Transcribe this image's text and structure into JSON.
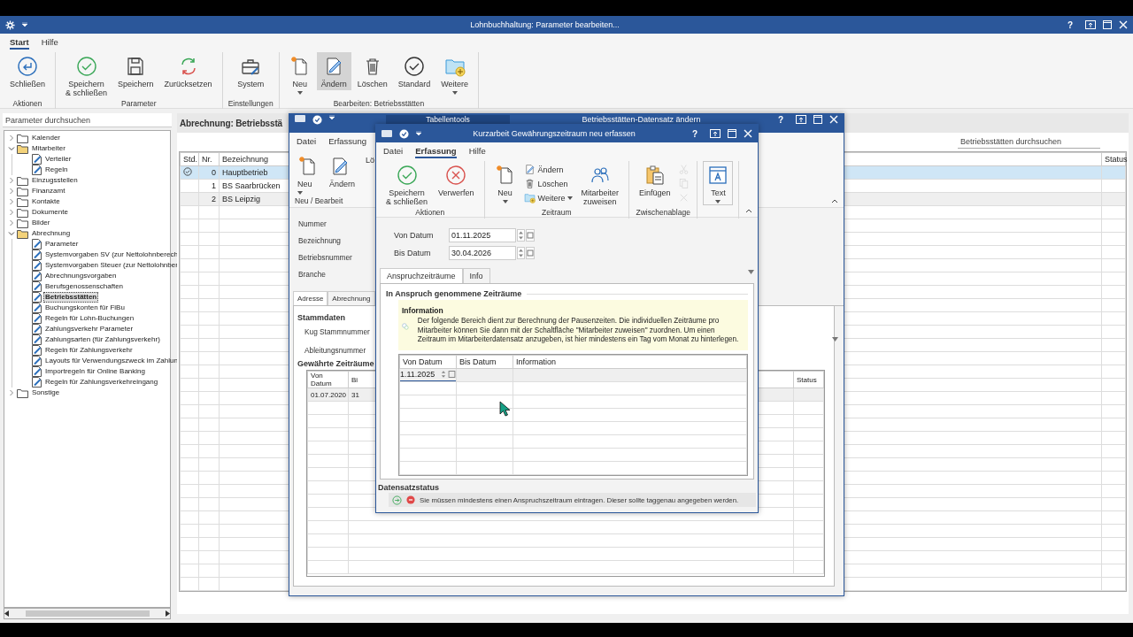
{
  "window": {
    "title": "Lohnbuchhaltung: Parameter bearbeiten...",
    "help": "?"
  },
  "ribbon": {
    "tabs": [
      {
        "label": "Start",
        "selected": true
      },
      {
        "label": "Hilfe",
        "selected": false
      }
    ],
    "groups": [
      {
        "label": "Aktionen",
        "buttons": [
          {
            "label": "Schließen",
            "pressed": false,
            "dropdown": false
          }
        ]
      },
      {
        "label": "Parameter",
        "buttons": [
          {
            "label": "Speichern\n& schließen",
            "pressed": false,
            "dropdown": false
          },
          {
            "label": "Speichern",
            "pressed": false,
            "dropdown": false
          },
          {
            "label": "Zurücksetzen",
            "pressed": false,
            "dropdown": false
          }
        ]
      },
      {
        "label": "Einstellungen",
        "buttons": [
          {
            "label": "System",
            "pressed": false,
            "dropdown": false
          }
        ]
      },
      {
        "label": "Bearbeiten: Betriebsstätten",
        "buttons": [
          {
            "label": "Neu",
            "pressed": false,
            "dropdown": true
          },
          {
            "label": "Ändern",
            "pressed": true,
            "dropdown": false
          },
          {
            "label": "Löschen",
            "pressed": false,
            "dropdown": false
          },
          {
            "label": "Standard",
            "pressed": false,
            "dropdown": false
          },
          {
            "label": "Weitere",
            "pressed": false,
            "dropdown": true
          }
        ]
      }
    ]
  },
  "sidebar": {
    "search": {
      "placeholder": "Parameter durchsuchen"
    },
    "tree": [
      {
        "kind": "folder",
        "label": "Kalender",
        "expanded": false,
        "selected": false
      },
      {
        "kind": "folder",
        "label": "Mitarbeiter",
        "expanded": true,
        "selected": false,
        "children": [
          {
            "kind": "leaf",
            "label": "Verteiler",
            "selected": false
          },
          {
            "kind": "leaf",
            "label": "Regeln",
            "selected": false
          }
        ]
      },
      {
        "kind": "folder",
        "label": "Einzugsstellen",
        "expanded": false,
        "selected": false
      },
      {
        "kind": "folder",
        "label": "Finanzamt",
        "expanded": false,
        "selected": false
      },
      {
        "kind": "folder",
        "label": "Kontakte",
        "expanded": false,
        "selected": false
      },
      {
        "kind": "folder",
        "label": "Dokumente",
        "expanded": false,
        "selected": false
      },
      {
        "kind": "folder",
        "label": "Bilder",
        "expanded": false,
        "selected": false
      },
      {
        "kind": "folder",
        "label": "Abrechnung",
        "expanded": true,
        "selected": false,
        "children": [
          {
            "kind": "leaf",
            "label": "Parameter",
            "selected": false
          },
          {
            "kind": "leaf",
            "label": "Systemvorgaben SV (zur Nettolohnberech",
            "selected": false
          },
          {
            "kind": "leaf",
            "label": "Systemvorgaben Steuer (zur Nettolohnber",
            "selected": false
          },
          {
            "kind": "leaf",
            "label": "Abrechnungsvorgaben",
            "selected": false
          },
          {
            "kind": "leaf",
            "label": "Berufsgenossenschaften",
            "selected": false
          },
          {
            "kind": "leaf",
            "label": "Betriebsstätten",
            "selected": true
          },
          {
            "kind": "leaf",
            "label": "Buchungskonten für FiBu",
            "selected": false
          },
          {
            "kind": "leaf",
            "label": "Regeln für Lohn-Buchungen",
            "selected": false
          },
          {
            "kind": "leaf",
            "label": "Zahlungsverkehr Parameter",
            "selected": false
          },
          {
            "kind": "leaf",
            "label": "Zahlungsarten (für Zahlungsverkehr)",
            "selected": false
          },
          {
            "kind": "leaf",
            "label": "Regeln für Zahlungsverkehr",
            "selected": false
          },
          {
            "kind": "leaf",
            "label": "Layouts für Verwendungszweck im Zahlun",
            "selected": false
          },
          {
            "kind": "leaf",
            "label": "Importregeln für Online Banking",
            "selected": false
          },
          {
            "kind": "leaf",
            "label": "Regeln für Zahlungsverkehreingang",
            "selected": false
          }
        ]
      },
      {
        "kind": "folder",
        "label": "Sonstige",
        "expanded": false,
        "selected": false
      }
    ]
  },
  "content": {
    "title": "Abrechnung: Betriebsstä",
    "search": {
      "placeholder": "Betriebsstätten durchsuchen"
    },
    "table": {
      "columns": [
        "Std.",
        "Nr.",
        "Bezeichnung",
        "Status"
      ],
      "rows": [
        {
          "default": true,
          "nr": "0",
          "name": "Hauptbetrieb",
          "selected": true
        },
        {
          "default": false,
          "nr": "1",
          "name": "BS Saarbrücken",
          "selected": false
        },
        {
          "default": false,
          "nr": "2",
          "name": "BS Leipzig",
          "selected": false
        }
      ]
    }
  },
  "edit_dialog": {
    "context_tab": "Tabellentools",
    "title": "Betriebsstätten-Datensatz ändern",
    "help": "?",
    "tabs": [
      {
        "label": "Datei",
        "selected": false
      },
      {
        "label": "Erfassung",
        "selected": false
      }
    ],
    "groups": [
      {
        "label": "Neu / Bearbeit",
        "buttons": [
          {
            "label": "Neu",
            "dropdown": true
          },
          {
            "label": "Ändern",
            "dropdown": false
          },
          {
            "label": "Lö",
            "dropdown": false
          }
        ]
      }
    ],
    "fields": [
      "Nummer",
      "Bezeichnung",
      "Betriebsnummer",
      "Branche"
    ],
    "tabs2": [
      {
        "label": "Adresse",
        "selected": true
      },
      {
        "label": "Abrechnung",
        "selected": false
      }
    ],
    "master_section": "Stammdaten",
    "master_fields": [
      "Kug Stammnummer",
      "Ableitungsnummer"
    ],
    "periods_section": "Gewährte Zeiträume",
    "periods_table": {
      "columns": [
        "Von Datum",
        "Bi",
        "Status"
      ],
      "rows": [
        {
          "cells": [
            "01.07.2020",
            "31"
          ],
          "selected": true
        }
      ]
    }
  },
  "period_dialog": {
    "title": "Kurzarbeit Gewährungszeitraum neu erfassen",
    "help": "?",
    "tabs": [
      {
        "label": "Datei",
        "selected": false
      },
      {
        "label": "Erfassung",
        "selected": true
      },
      {
        "label": "Hilfe",
        "selected": false
      }
    ],
    "groups": [
      {
        "label": "Aktionen",
        "buttons": [
          {
            "kind": "large",
            "label": "Speichern\n& schließen",
            "dropdown": false,
            "disabled": false
          },
          {
            "kind": "large",
            "label": "Verwerfen",
            "dropdown": false,
            "disabled": false
          }
        ]
      },
      {
        "label": "Zeitraum",
        "buttons": [
          {
            "kind": "large",
            "label": "Neu",
            "dropdown": true,
            "disabled": false
          },
          {
            "kind": "small",
            "label": "Ändern",
            "dropdown": false,
            "disabled": false
          },
          {
            "kind": "small",
            "label": "Löschen",
            "dropdown": false,
            "disabled": false
          },
          {
            "kind": "small",
            "label": "Weitere",
            "dropdown": true,
            "disabled": false
          },
          {
            "kind": "large",
            "label": "Mitarbeiter\nzuweisen",
            "dropdown": false,
            "disabled": false
          }
        ]
      },
      {
        "label": "Zwischenablage",
        "buttons": [
          {
            "kind": "large",
            "label": "Einfügen",
            "dropdown": false,
            "disabled": false
          },
          {
            "kind": "icon",
            "dropdown": false,
            "disabled": true
          },
          {
            "kind": "icon",
            "dropdown": false,
            "disabled": true
          },
          {
            "kind": "icon",
            "dropdown": false,
            "disabled": true
          }
        ]
      },
      {
        "buttons": [
          {
            "kind": "framed",
            "label": "Text",
            "dropdown": true,
            "disabled": false
          }
        ]
      }
    ],
    "fields": [
      {
        "label": "Von Datum",
        "value": "01.11.2025"
      },
      {
        "label": "Bis Datum",
        "value": "30.04.2026"
      }
    ],
    "tabs2": [
      {
        "label": "Anspruchzeiträume",
        "selected": true
      },
      {
        "label": "Info",
        "selected": false
      }
    ],
    "section": "In Anspruch genommene Zeiträume",
    "info": {
      "title": "Information",
      "text": "Der folgende Bereich dient zur Berechnung der Pausenzeiten. Die individuellen Zeiträume pro Mitarbeiter können Sie dann mit der Schaltfläche \"Mitarbeiter zuweisen\" zuordnen. Um einen Zeitraum im Mitarbeiterdatensatz anzugeben, ist hier mindestens ein Tag vom Monat zu hinterlegen."
    },
    "table": {
      "columns": [
        "Von Datum",
        "Bis Datum",
        "Information"
      ],
      "editor": {
        "value": "1.11.2025"
      }
    },
    "status": {
      "title": "Datensatzstatus",
      "message": "Sie müssen mindestens einen Anspruchszeitraum eintragen. Dieser sollte taggenau angegeben werden."
    }
  }
}
